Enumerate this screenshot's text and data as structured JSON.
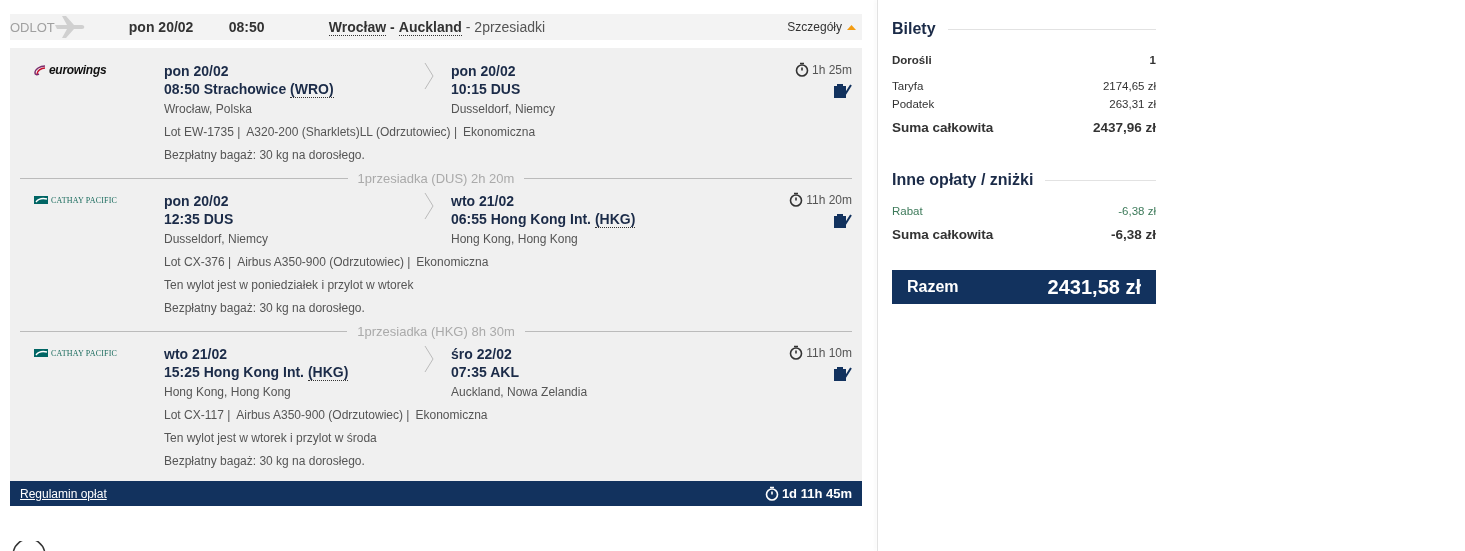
{
  "header": {
    "label": "ODLOT",
    "date": "pon 20/02",
    "time": "08:50",
    "from": "Wrocław",
    "separator": "-",
    "to": "Auckland",
    "stops": "- 2przesiadki",
    "details": "Szczegóły",
    "expanded": true
  },
  "segments": [
    {
      "kind": "eurowings",
      "logo": "eurowings",
      "dep": {
        "date": "pon 20/02",
        "place": "08:50 Strachowice",
        "code": "(WRO)",
        "city": "Wrocław, Polska"
      },
      "arr": {
        "date": "pon 20/02",
        "place": "10:15 DUS",
        "city": "Dusseldorf, Niemcy"
      },
      "details": [
        "Lot EW-1735 |",
        "A320-200 (Sharklets)LL (Odrzutowiec) |",
        "Ekonomiczna"
      ],
      "baggage": "Bezpłatny bagaż: 30 kg na dorosłego.",
      "duration": "1h 25m",
      "layover": "1przesiadka (DUS) 2h 20m"
    },
    {
      "kind": "cathay",
      "logo": "CATHAY PACIFIC",
      "dep": {
        "date": "pon 20/02",
        "place": "12:35 DUS",
        "city": "Dusseldorf, Niemcy"
      },
      "arr": {
        "date": "wto 21/02",
        "place": "06:55 Hong Kong Int.",
        "code": "(HKG)",
        "city": "Hong Kong, Hong Kong"
      },
      "details": [
        "Lot CX-376 |",
        "Airbus A350-900 (Odrzutowiec) |",
        "Ekonomiczna"
      ],
      "note": "Ten wylot jest w poniedziałek i przylot w wtorek",
      "baggage": "Bezpłatny bagaż: 30 kg na dorosłego.",
      "duration": "11h 20m",
      "layover": "1przesiadka (HKG) 8h 30m"
    },
    {
      "kind": "cathay",
      "logo": "CATHAY PACIFIC",
      "dep": {
        "date": "wto 21/02",
        "place": "15:25 Hong Kong Int.",
        "code": "(HKG)",
        "city": "Hong Kong, Hong Kong"
      },
      "arr": {
        "date": "śro 22/02",
        "place": "07:35 AKL",
        "city": "Auckland, Nowa Zelandia"
      },
      "details": [
        "Lot CX-117 |",
        "Airbus A350-900 (Odrzutowiec) |",
        "Ekonomiczna"
      ],
      "note": "Ten wylot jest w wtorek i przylot w środa",
      "baggage": "Bezpłatny bagaż: 30 kg na dorosłego.",
      "duration": "11h 10m"
    }
  ],
  "footer": {
    "link": "Regulamin opłat",
    "total_duration": "1d 11h 45m"
  },
  "summary": {
    "sections": [
      {
        "title": "Bilety",
        "rows": [
          {
            "kind": "bold",
            "label": "Dorośli",
            "value": "1"
          },
          {
            "kind": "plain",
            "label": "Taryfa",
            "value": "2174,65 zł"
          },
          {
            "kind": "plain",
            "label": "Podatek",
            "value": "263,31 zł"
          },
          {
            "kind": "total",
            "label": "Suma całkowita",
            "value": "2437,96 zł"
          }
        ]
      },
      {
        "title": "Inne opłaty / zniżki",
        "rows": [
          {
            "kind": "discount",
            "label": "Rabat",
            "value": "-6,38 zł"
          },
          {
            "kind": "total",
            "label": "Suma całkowita",
            "value": "-6,38 zł"
          }
        ]
      }
    ],
    "total_label": "Razem",
    "total_value": "2431,58 zł"
  }
}
